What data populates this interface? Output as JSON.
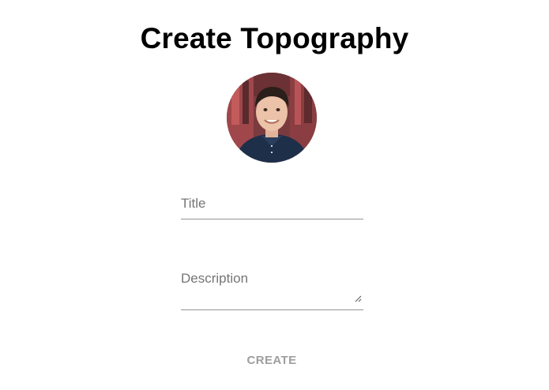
{
  "page": {
    "title": "Create Topography"
  },
  "avatar": {
    "alt_icon": "user-photo"
  },
  "form": {
    "title_field": {
      "label": "Title",
      "value": ""
    },
    "description_field": {
      "label": "Description",
      "value": ""
    },
    "submit_label": "CREATE"
  },
  "colors": {
    "text_primary": "#000000",
    "label": "#757575",
    "underline": "#949494",
    "button_disabled": "#9e9e9e",
    "background": "#ffffff"
  }
}
